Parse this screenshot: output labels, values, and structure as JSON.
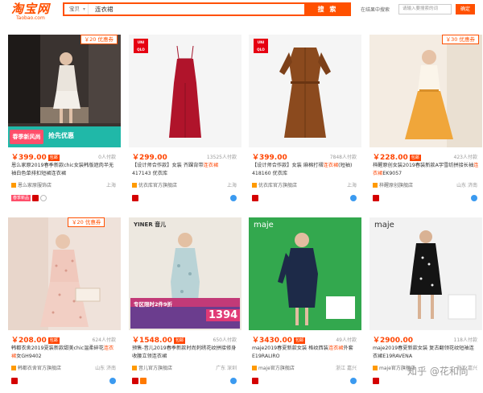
{
  "header": {
    "logo_main": "淘宝网",
    "logo_sub": "Taobao.com",
    "search_category": "宝贝",
    "search_query": "连衣裙",
    "search_button": "搜 索",
    "in_result_label": "在结果中搜索",
    "in_result_placeholder": "请输入要搜索的词",
    "in_result_button": "确定"
  },
  "products": [
    {
      "coupon": "￥20 优惠券",
      "promo_tag": "春季新风尚",
      "promo_sub": "抢先优惠",
      "price": "￥399.00",
      "ship": "包邮",
      "sales": "0人付款",
      "title_a": "恩么家原2019春季新款chic女装韩版遮肉半",
      "title_hl": "",
      "title_b": "无袖白色单排扣短裙连衣裙",
      "shop": "恩么家原服饰店",
      "loc": "上海",
      "badge": "春季新品"
    },
    {
      "brand": "UNI QLO",
      "price": "￥299.00",
      "ship": "",
      "sales": "13525人付款",
      "title_a": "【设计师合作款】女装 齐踝背带",
      "title_hl": "连衣裙",
      "title_b": " 417143 优衣库",
      "shop": "优衣库官方旗舰店",
      "loc": "上海",
      "badge": ""
    },
    {
      "brand": "UNI QLO",
      "price": "￥399.00",
      "ship": "",
      "sales": "7848人付款",
      "title_a": "【设计师合作款】女装 麻棉打褶",
      "title_hl": "连衣裙",
      "title_b": "(短袖) 418160 优衣库",
      "shop": "优衣库官方旗舰店",
      "loc": "上海",
      "badge": ""
    },
    {
      "coupon": "￥30 优惠券",
      "price": "￥228.00",
      "ship": "包邮",
      "sales": "423人付款",
      "title_a": "梓醒原创女装2019春装新款A字雪纺拼接长袖",
      "title_hl": "连衣裙",
      "title_b": "EK9057",
      "shop": "梓醒原创旗舰店",
      "loc": "山东 济南",
      "badge": ""
    },
    {
      "coupon": "￥20 优惠券",
      "price": "￥208.00",
      "ship": "包邮",
      "sales": "624人付款",
      "title_a": "韩都衣舍2019夏装新款甜美chic温柔碎花",
      "title_hl": "连衣裙",
      "title_b": "女GH9402",
      "shop": "韩都衣舍官方旗舰店",
      "loc": "山东 济南",
      "badge": ""
    },
    {
      "brand": "YINER 音儿",
      "price": "￥1548.00",
      "ship": "包邮",
      "sales": "650人付款",
      "title_a": "预售-音儿2019春季新款时尚刺绣花纹拼",
      "title_hl": "",
      "title_b": "接修身收腰立领连衣裙",
      "shop": "音儿官方旗舰店",
      "loc": "广东 深圳",
      "badge": "专区限时2件9折",
      "banner_price": "1394"
    },
    {
      "brand": "maje",
      "price": "￥3430.00",
      "ship": "包邮",
      "sales": "49人付款",
      "title_a": "maje2019春夏新款女装 格纹西装",
      "title_hl": "连衣裙",
      "title_b": "外套E19RALIRO",
      "shop": "maje官方旗舰店",
      "loc": "浙江 嘉兴",
      "badge": ""
    },
    {
      "brand": "maje",
      "price": "￥2900.00",
      "ship": "",
      "sales": "118人付款",
      "title_a": "maje2019春夏新款女装 复古翻领花纹短袖",
      "title_hl": "",
      "title_b": "连衣裙E19RAVENA",
      "shop": "maje官方旗舰店",
      "loc": "浙江 嘉兴",
      "badge": ""
    }
  ],
  "watermark": "知乎 @花和尚",
  "colors": {
    "accent": "#ff5000",
    "price": "#ff4400"
  }
}
